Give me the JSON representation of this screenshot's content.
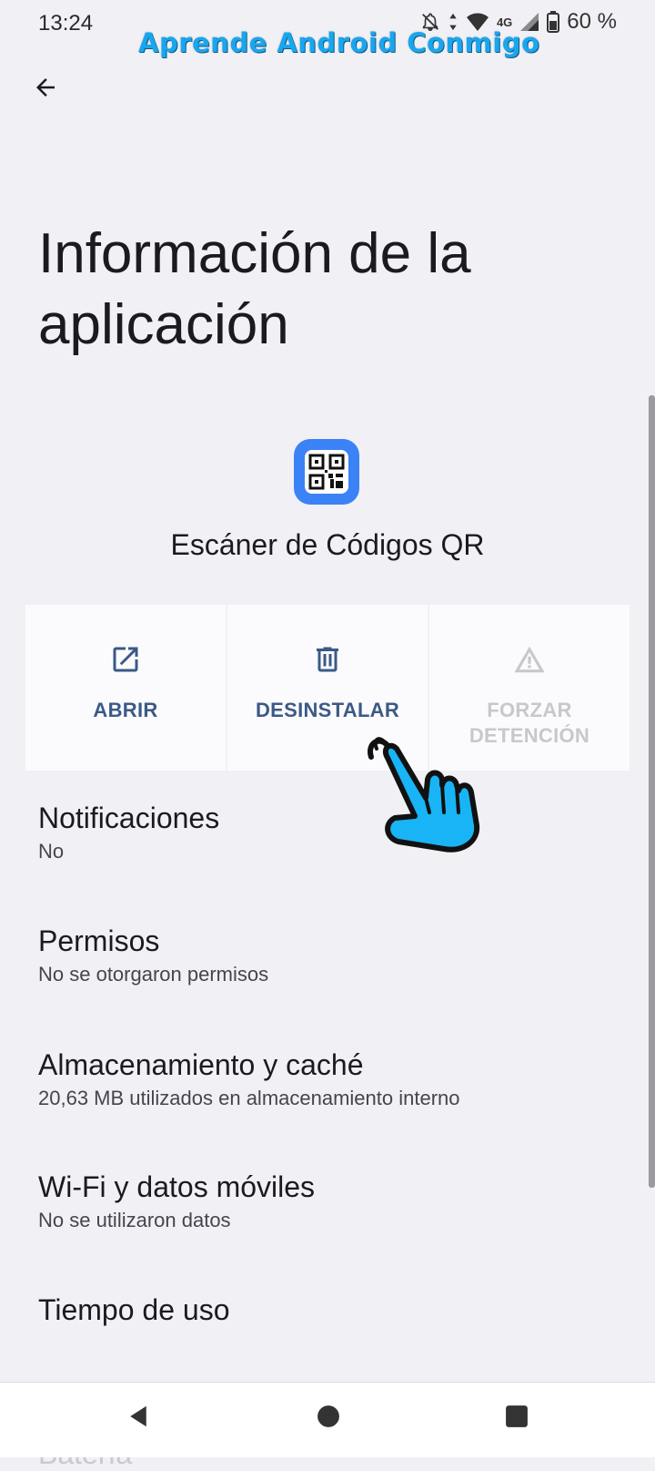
{
  "status_bar": {
    "time": "13:24",
    "network": "4G",
    "battery": "60 %",
    "icons": [
      "mute-icon",
      "data-arrows-icon",
      "wifi-icon",
      "signal-icon",
      "battery-icon"
    ]
  },
  "watermark": "Aprende Android Conmigo",
  "header": {
    "title": "Información de la aplicación",
    "back_icon": "arrow-back-icon"
  },
  "app": {
    "name": "Escáner de Códigos QR",
    "icon": "qr-code-icon",
    "icon_color": "#3b82f6"
  },
  "actions": [
    {
      "label": "ABRIR",
      "icon": "open-external-icon",
      "enabled": true
    },
    {
      "label": "DESINSTALAR",
      "icon": "trash-icon",
      "enabled": true
    },
    {
      "label": "FORZAR DETENCIÓN",
      "icon": "warning-icon",
      "enabled": false
    }
  ],
  "settings": [
    {
      "title": "Notificaciones",
      "subtitle": "No"
    },
    {
      "title": "Permisos",
      "subtitle": "No se otorgaron permisos"
    },
    {
      "title": "Almacenamiento y caché",
      "subtitle": "20,63 MB utilizados en almacenamiento interno"
    },
    {
      "title": "Wi-Fi y datos móviles",
      "subtitle": "No se utilizaron datos"
    },
    {
      "title": "Tiempo de uso",
      "subtitle": ""
    },
    {
      "title": "Batería",
      "subtitle": ""
    }
  ],
  "nav_bar": {
    "icons": [
      "nav-back-icon",
      "nav-home-icon",
      "nav-recents-icon"
    ]
  },
  "colors": {
    "background": "#f1f0f5",
    "accent": "#3b5a86",
    "disabled": "#c7c8cc",
    "watermark": "#1aa6ee",
    "pointer_hand": "#19b4f5"
  },
  "overlay": {
    "pointer": "pointing-hand-icon"
  }
}
